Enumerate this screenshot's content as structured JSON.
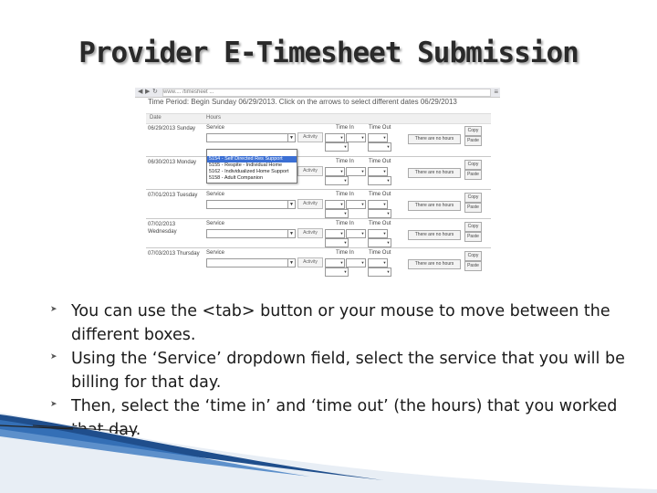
{
  "title": "Provider E-Timesheet Submission",
  "screenshot": {
    "url": "www.... /timesheet ... ",
    "period_text": "Time Period: Begin Sunday 06/29/2013. Click on the arrows to select different dates 06/29/2013",
    "header": {
      "date": "Date",
      "hours": "Hours"
    },
    "labels": {
      "service": "Service",
      "activity": "Activity",
      "time_in": "Time In",
      "time_out": "Time Out",
      "hours_button": "There are no hours",
      "copy": "Copy",
      "paste": "Paste"
    },
    "rows": [
      {
        "date": "06/29/2013 Sunday"
      },
      {
        "date": "06/30/2013 Monday"
      },
      {
        "date": "07/01/2013 Tuesday"
      },
      {
        "date": "07/02/2013 Wednesday"
      },
      {
        "date": "07/03/2013 Thursday"
      }
    ],
    "dropdown_options": [
      "",
      "5154 - Self Directed Res Support",
      "5155 - Respite - Individual Home",
      "5162 - Individualized Home Support",
      "5158 - Adult Companion"
    ]
  },
  "bullets": [
    "You can use the <tab> button or your mouse to move between the different boxes.",
    "Using the ‘Service’ dropdown field, select the service that you will be billing for that day.",
    "Then, select the ‘time in’ and ‘time out’ (the hours) that you worked that day."
  ],
  "bullet_icon": "arrow-bullet-icon"
}
